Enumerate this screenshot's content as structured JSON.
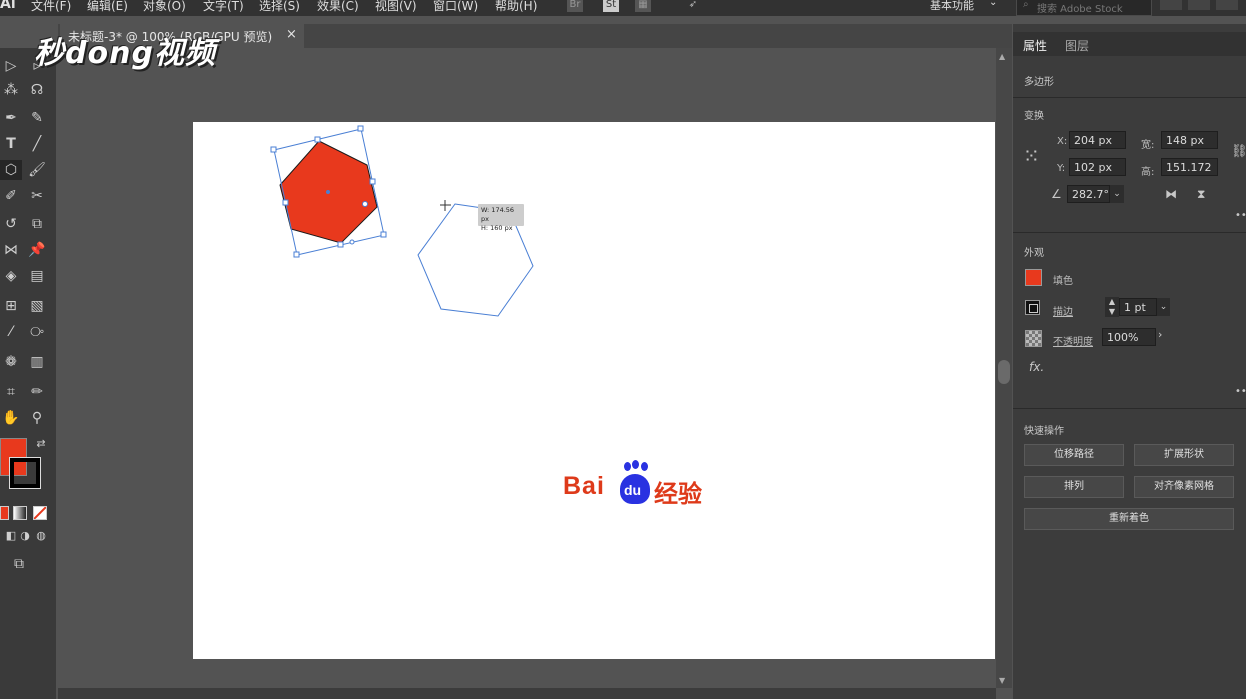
{
  "app": {
    "logo": "Ai",
    "menu": [
      "文件(F)",
      "编辑(E)",
      "对象(O)",
      "文字(T)",
      "选择(S)",
      "效果(C)",
      "视图(V)",
      "窗口(W)",
      "帮助(H)"
    ],
    "bridge_label": "Br",
    "stock_label": "St",
    "workspace": "基本功能",
    "search_placeholder": "搜索 Adobe Stock"
  },
  "document": {
    "tab_title": "未标题-3* @ 100% (RGB/GPU 预览)",
    "close_glyph": "×"
  },
  "watermark": "秒dong视频",
  "canvas": {
    "tooltip_w": "W: 174.56 px",
    "tooltip_h": "H: 160 px",
    "brand_bai": "Bai",
    "brand_du": "du",
    "brand_jingyan": "经验",
    "colors": {
      "fill": "#e8391d",
      "selection": "#4a7fd4",
      "brand_red": "#de3a1a",
      "brand_blue": "#2932e1"
    }
  },
  "panel": {
    "tabs": [
      "属性",
      "图层"
    ],
    "object_type": "多边形",
    "transform": {
      "title": "变换",
      "x_label": "X:",
      "x_value": "204 px",
      "y_label": "Y:",
      "y_value": "102 px",
      "w_label": "宽:",
      "w_value": "148 px",
      "h_label": "高:",
      "h_value": "151.172",
      "rotate_value": "282.7°"
    },
    "appearance": {
      "title": "外观",
      "fill_label": "填色",
      "stroke_label": "描边",
      "stroke_value": "1 pt",
      "opacity_label": "不透明度",
      "opacity_value": "100%",
      "fx_label": "fx."
    },
    "quick_actions": {
      "title": "快速操作",
      "offset_path": "位移路径",
      "expand_shape": "扩展形状",
      "arrange": "排列",
      "align_pixel_grid": "对齐像素网格",
      "recolor": "重新着色"
    }
  }
}
